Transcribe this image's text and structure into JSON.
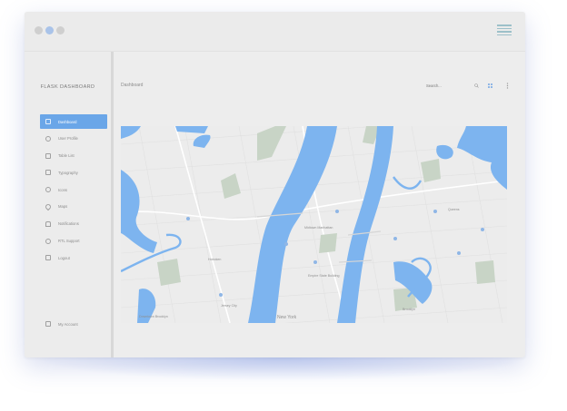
{
  "window": {
    "colors": {
      "accent": "#6aa6e8",
      "water": "#7db4ef",
      "park": "#c8d4c6",
      "background": "#ededed"
    }
  },
  "titlebar": {
    "menu_icon": "hamburger-menu-icon"
  },
  "sidebar": {
    "brand": "FLASK DASHBOARD",
    "items": [
      {
        "label": "Dashboard",
        "icon": "dashboard-icon",
        "active": true
      },
      {
        "label": "User Profile",
        "icon": "user-icon",
        "active": false
      },
      {
        "label": "Table List",
        "icon": "clipboard-icon",
        "active": false
      },
      {
        "label": "Typography",
        "icon": "book-icon",
        "active": false
      },
      {
        "label": "Icons",
        "icon": "cloud-icon",
        "active": false
      },
      {
        "label": "Maps",
        "icon": "map-marker-icon",
        "active": false
      },
      {
        "label": "Notifications",
        "icon": "bell-icon",
        "active": false
      },
      {
        "label": "RTL Support",
        "icon": "globe-icon",
        "active": false
      },
      {
        "label": "Logout",
        "icon": "logout-icon",
        "active": false
      }
    ],
    "bottom": {
      "label": "My Account",
      "icon": "account-icon"
    }
  },
  "topbar": {
    "breadcrumb": "Dashboard",
    "search": {
      "placeholder": "Search..."
    },
    "icons": [
      "search-icon",
      "grid-icon",
      "more-vertical-icon"
    ]
  },
  "map": {
    "labels": {
      "midtown": "Midtown Manhattan",
      "jersey_city": "Jersey City",
      "new_york": "New York",
      "brooklyn": "Brooklyn",
      "queens": "Queens",
      "empire_state": "Empire State Building",
      "hoboken": "Hoboken",
      "downtown": "Downtown Brooklyn"
    }
  }
}
